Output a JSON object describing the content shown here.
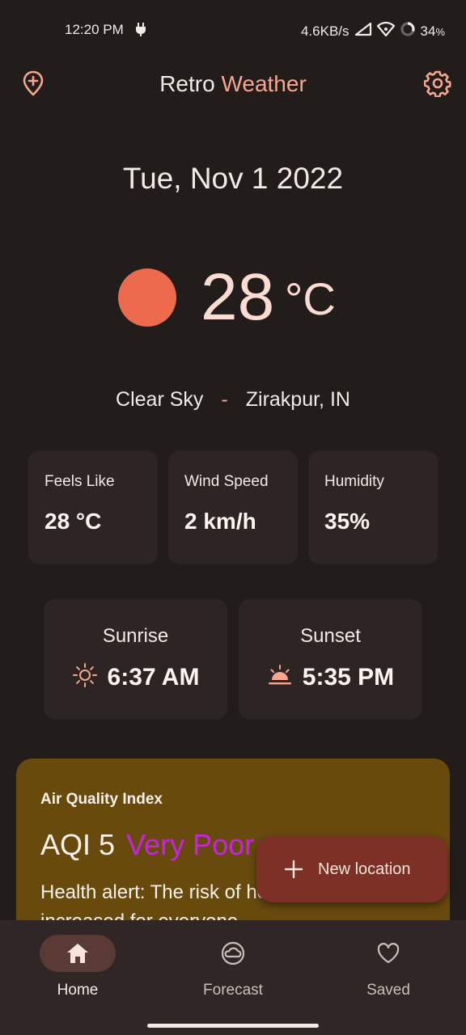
{
  "status_bar": {
    "time": "12:20 PM",
    "speed": "4.6KB/s",
    "battery": "34",
    "battery_unit": "%"
  },
  "app_bar": {
    "title_part1": "Retro",
    "title_part2": "Weather",
    "left_icon": "add-location-icon",
    "right_icon": "gear-icon"
  },
  "date": "Tue, Nov 1 2022",
  "current": {
    "temp": "28",
    "unit": "°C",
    "condition": "Clear Sky",
    "separator": "-",
    "location": "Zirakpur, IN"
  },
  "metrics": [
    {
      "label": "Feels Like",
      "value": "28 °C"
    },
    {
      "label": "Wind Speed",
      "value": "2 km/h"
    },
    {
      "label": "Humidity",
      "value": "35%"
    }
  ],
  "sun": {
    "sunrise_label": "Sunrise",
    "sunrise_time": "6:37 AM",
    "sunset_label": "Sunset",
    "sunset_time": "5:35 PM"
  },
  "aqi": {
    "title": "Air Quality Index",
    "value": "AQI 5",
    "status": "Very Poor",
    "alert": "Health alert: The risk of health effects is increased for everyone."
  },
  "fab": {
    "label": "New location"
  },
  "nav": [
    {
      "label": "Home",
      "icon": "home-icon",
      "active": true
    },
    {
      "label": "Forecast",
      "icon": "cloud-icon",
      "active": false
    },
    {
      "label": "Saved",
      "icon": "heart-icon",
      "active": false
    }
  ],
  "colors": {
    "background": "#221c1b",
    "accent": "#f6a68f",
    "sun": "#ec6a4d",
    "card": "#2d2524",
    "aqi_card": "#684a0d",
    "aqi_status": "#c724e0",
    "fab": "#7c3026"
  }
}
